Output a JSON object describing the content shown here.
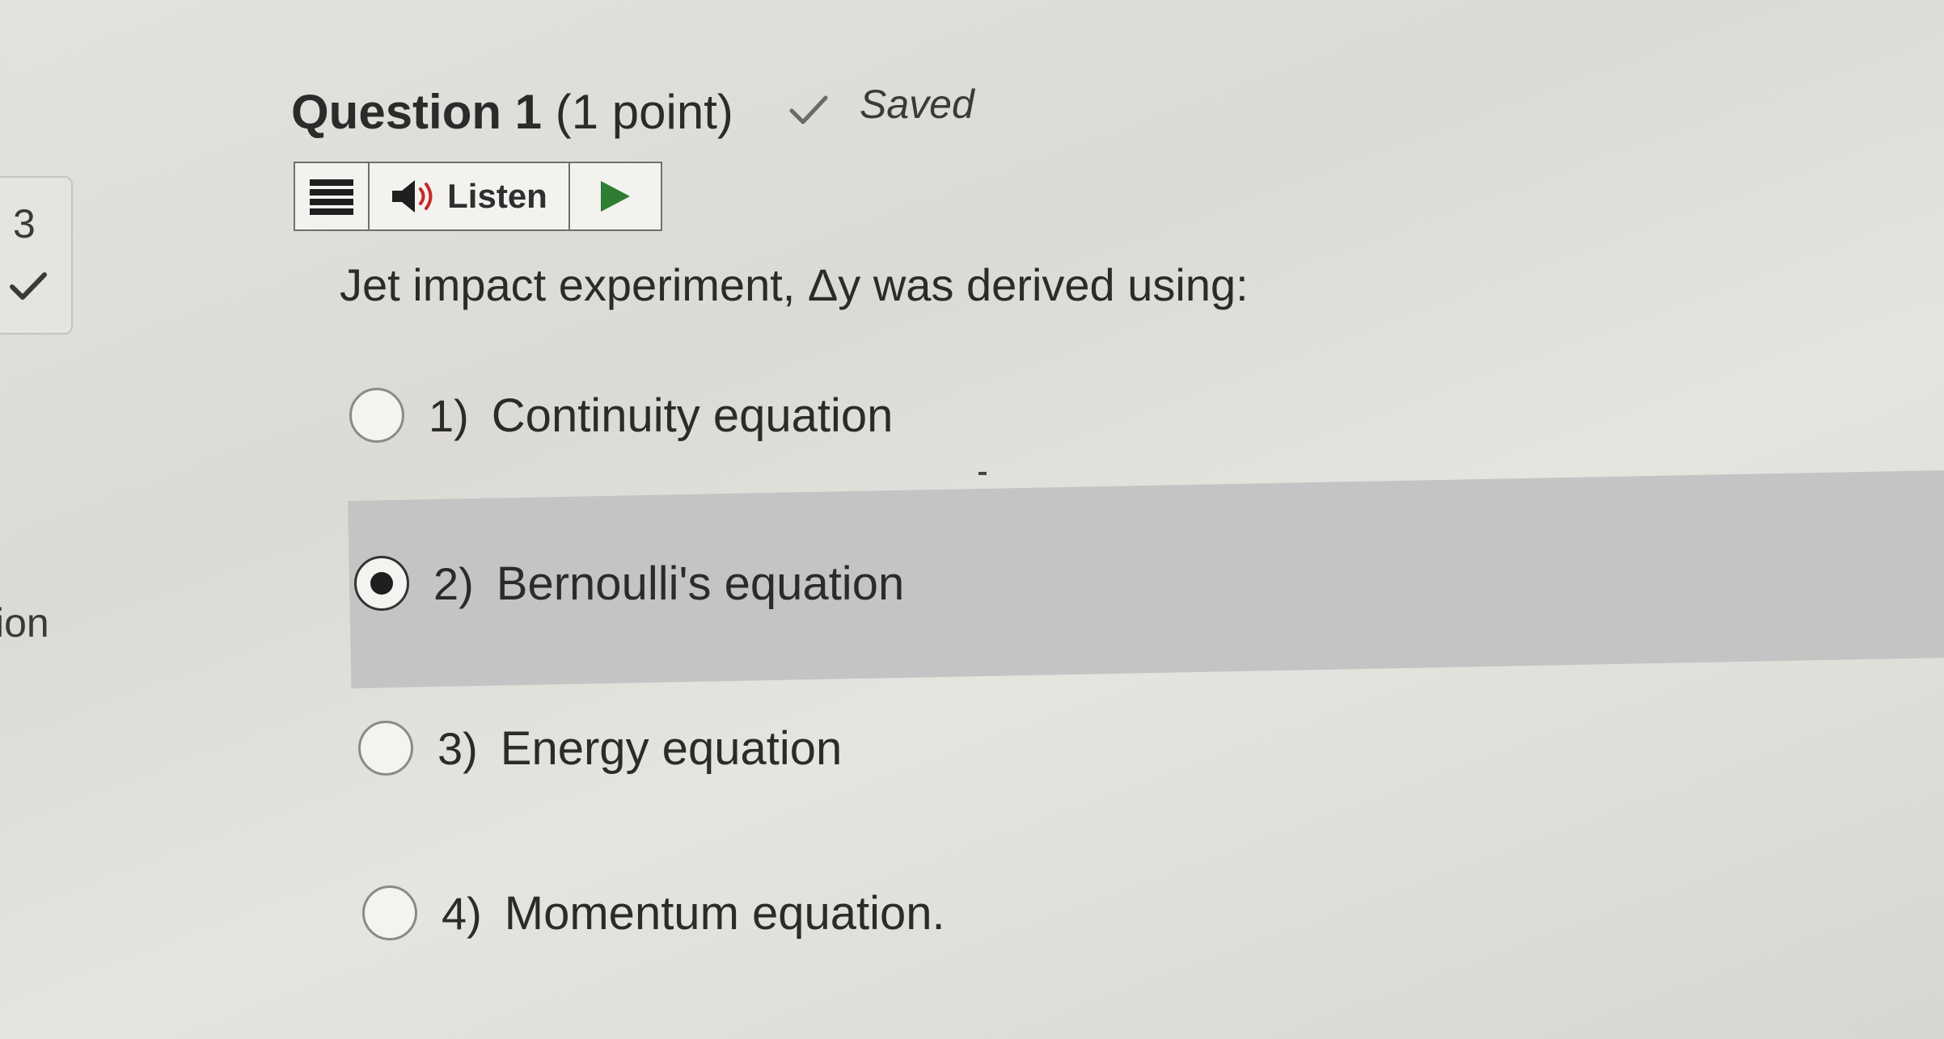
{
  "nav": {
    "question_number": "3",
    "fragment_text": "ion"
  },
  "header": {
    "question_title": "Question 1",
    "points": "(1 point)",
    "saved_label": "Saved"
  },
  "toolbar": {
    "listen_label": "Listen"
  },
  "question": {
    "text": "Jet impact experiment, Δy was derived using:"
  },
  "options": [
    {
      "number": "1)",
      "label": "Continuity equation",
      "selected": false
    },
    {
      "number": "2)",
      "label": "Bernoulli's equation",
      "selected": true
    },
    {
      "number": "3)",
      "label": "Energy equation",
      "selected": false
    },
    {
      "number": "4)",
      "label": "Momentum equation.",
      "selected": false
    }
  ],
  "colors": {
    "background": "#e0ded9",
    "selected_highlight": "#c4c4c4",
    "play_green": "#2e7d32",
    "text": "#2b2b2b"
  },
  "icons": {
    "saved": "checkmark-icon",
    "nav_status": "checkmark-icon",
    "menu": "hamburger-menu-icon",
    "speaker": "speaker-icon",
    "play": "play-icon"
  }
}
